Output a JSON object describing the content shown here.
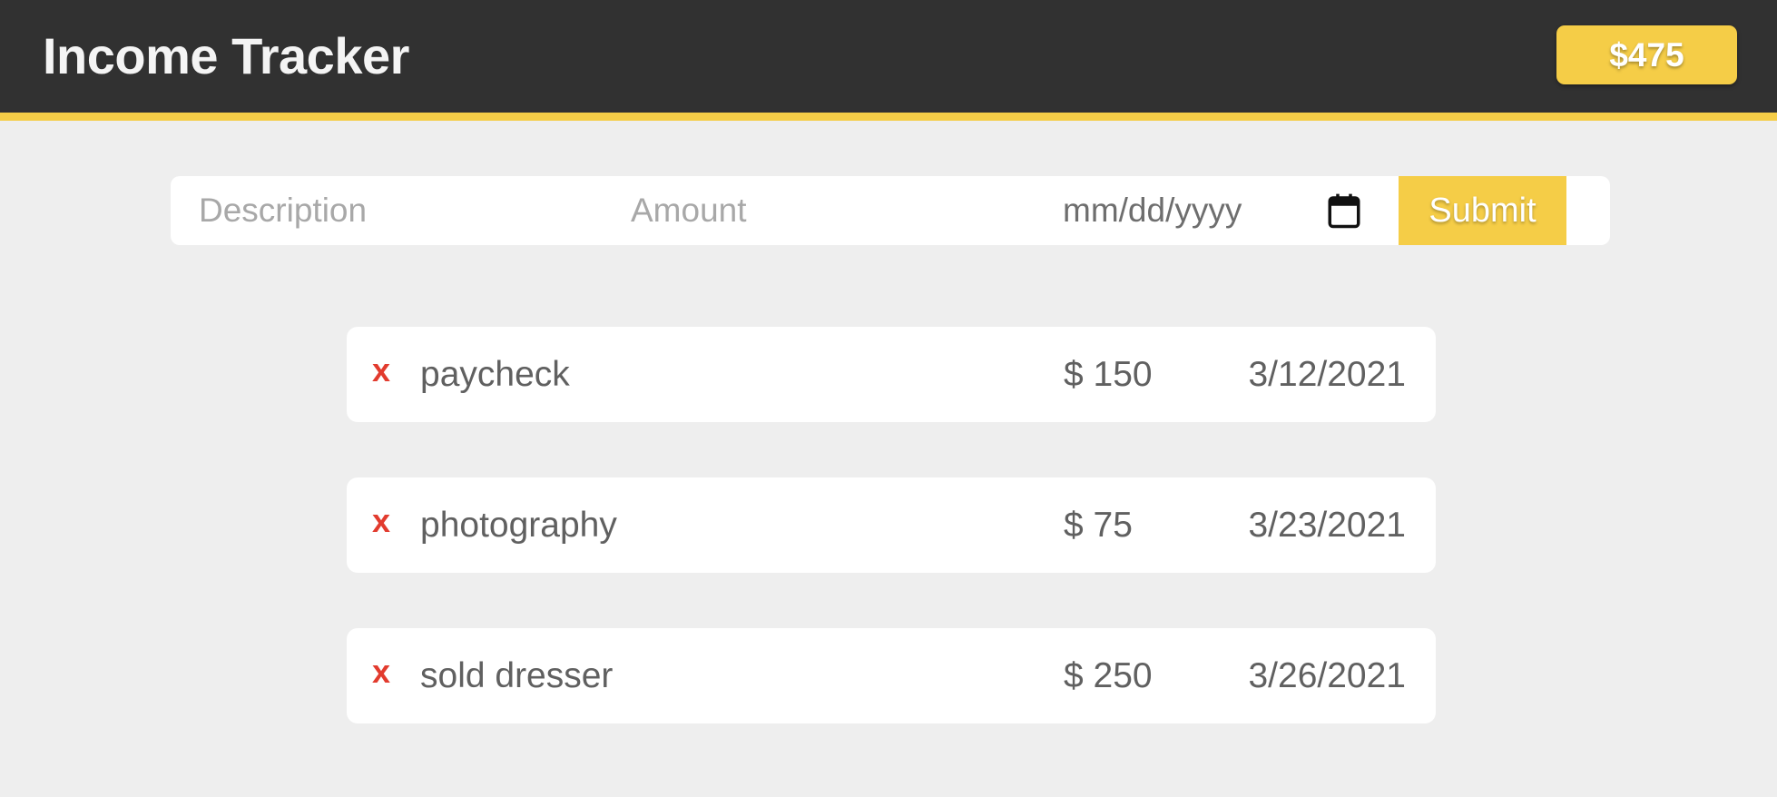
{
  "header": {
    "title": "Income Tracker",
    "total": "$475"
  },
  "form": {
    "description_placeholder": "Description",
    "amount_placeholder": "Amount",
    "date_placeholder": "mm/dd/yyyy",
    "submit_label": "Submit"
  },
  "entries": [
    {
      "delete_label": "x",
      "description": "paycheck",
      "amount": "$ 150",
      "date": "3/12/2021"
    },
    {
      "delete_label": "x",
      "description": "photography",
      "amount": "$ 75",
      "date": "3/23/2021"
    },
    {
      "delete_label": "x",
      "description": "sold dresser",
      "amount": "$ 250",
      "date": "3/26/2021"
    }
  ],
  "colors": {
    "header_bg": "#313131",
    "accent": "#f5cd47",
    "background": "#eeeeee",
    "delete": "#e23b2e"
  },
  "icons": {
    "date_picker": "calendar-icon",
    "delete": "close-icon"
  }
}
